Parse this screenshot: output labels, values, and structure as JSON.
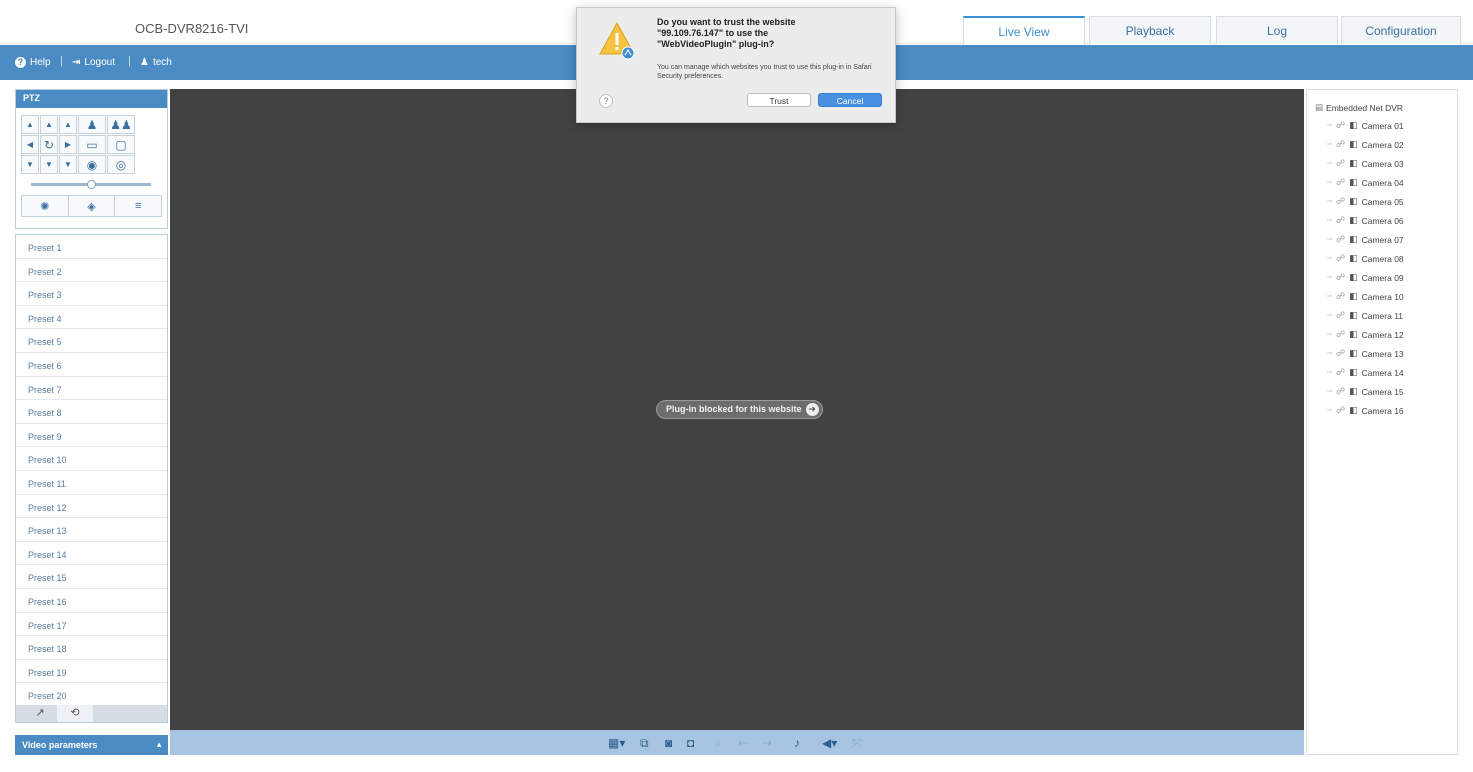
{
  "header": {
    "device_name": "OCB-DVR8216-TVI",
    "tabs": [
      {
        "label": "Live View",
        "active": true
      },
      {
        "label": "Playback",
        "active": false
      },
      {
        "label": "Log",
        "active": false
      },
      {
        "label": "Configuration",
        "active": false
      }
    ]
  },
  "userbar": {
    "help": "Help",
    "logout": "Logout",
    "user": "tech",
    "separator": "|"
  },
  "ptz": {
    "title": "PTZ",
    "speed_level": 0.5
  },
  "presets": [
    "Preset 1",
    "Preset 2",
    "Preset 3",
    "Preset 4",
    "Preset 5",
    "Preset 6",
    "Preset 7",
    "Preset 8",
    "Preset 9",
    "Preset 10",
    "Preset 11",
    "Preset 12",
    "Preset 13",
    "Preset 14",
    "Preset 15",
    "Preset 16",
    "Preset 17",
    "Preset 18",
    "Preset 19",
    "Preset 20"
  ],
  "video_parameters": {
    "label": "Video parameters",
    "caret": "▲"
  },
  "video": {
    "blocked_message": "Plug-in blocked for this website"
  },
  "camera_tree": {
    "root": "Embedded Net DVR",
    "cameras": [
      "Camera 01",
      "Camera 02",
      "Camera 03",
      "Camera 04",
      "Camera 05",
      "Camera 06",
      "Camera 07",
      "Camera 08",
      "Camera 09",
      "Camera 10",
      "Camera 11",
      "Camera 12",
      "Camera 13",
      "Camera 14",
      "Camera 15",
      "Camera 16"
    ]
  },
  "dialog": {
    "title": "Do you want to trust the website\n\"99.109.76.147\" to use the\n\"WebVideoPlugin\" plug-in?",
    "message": "You can manage which websites you trust to use this plug-in in Safari Security preferences.",
    "help": "?",
    "trust_label": "Trust",
    "cancel_label": "Cancel"
  },
  "colors": {
    "accent_blue": "#4b8bc4",
    "video_background": "#424242",
    "toolbar_blue": "#a7c5e2",
    "dialog_primary": "#4a90e2"
  }
}
